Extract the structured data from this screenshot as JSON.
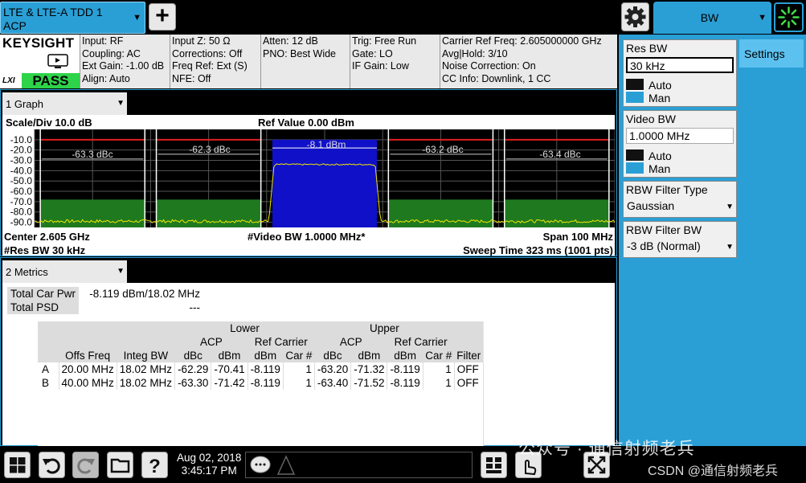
{
  "top_bar": {
    "mode_line1": "LTE & LTE-A TDD 1",
    "mode_line2": "ACP",
    "add_label": "+",
    "menu_label": "BW"
  },
  "info_bar": {
    "logo": "KEYSIGHT",
    "lxi": "LXI",
    "pass": "PASS",
    "col1": [
      "Input: RF",
      "Coupling: AC",
      "Ext Gain: -1.00 dB",
      "Align: Auto"
    ],
    "col2": [
      "Input Z: 50 Ω",
      "Corrections: Off",
      "Freq Ref: Ext (S)",
      "NFE: Off"
    ],
    "col3": [
      "Atten: 12 dB",
      "PNO: Best Wide"
    ],
    "col4": [
      "Trig: Free Run",
      "Gate: LO",
      "IF Gain: Low"
    ],
    "col5": [
      "Carrier Ref Freq: 2.605000000 GHz",
      "Avg|Hold: 3/10",
      "Noise Correction: On",
      "CC Info: Downlink, 1 CC"
    ]
  },
  "graph": {
    "tab": "1 Graph",
    "scale_div": "Scale/Div 10.0 dB",
    "ref_value": "Ref Value 0.00 dBm",
    "center": "Center 2.605 GHz",
    "video_bw": "#Video BW 1.0000 MHz*",
    "span": "Span 100 MHz",
    "res_bw": "#Res BW 30 kHz",
    "sweep": "Sweep Time 323 ms (1001 pts)",
    "y_ticks": [
      "-10.0",
      "-20.0",
      "-30.0",
      "-40.0",
      "-50.0",
      "-60.0",
      "-70.0",
      "-80.0",
      "-90.0"
    ],
    "band_labels": [
      "-63.3 dBc",
      "-62.3 dBc",
      "-8.1 dBm",
      "-63.2 dBc",
      "-63.4 dBc"
    ]
  },
  "chart_data": {
    "type": "line",
    "title": "",
    "y_ticks": [
      -10,
      -20,
      -30,
      -40,
      -50,
      -60,
      -70,
      -80,
      -90
    ],
    "ylim": [
      -95,
      0
    ],
    "x_center_ghz": 2.605,
    "x_span_mhz": 100,
    "channel_power_dbm": -8.1,
    "adjacent_dbc": [
      -63.3,
      -62.3,
      -63.2,
      -63.4
    ],
    "carrier_trace_level_dbm": -34,
    "noise_floor_dbm": -89,
    "limit_line_dbm": -10,
    "green_mask_dbm": -68
  },
  "metrics": {
    "tab": "2 Metrics",
    "total_car_pwr_label": "Total Car Pwr",
    "total_car_pwr_value": "-8.119 dBm/18.02 MHz",
    "total_psd_label": "Total PSD",
    "total_psd_value": "---",
    "header_lower": "Lower",
    "header_upper": "Upper",
    "header_acp": "ACP",
    "header_ref_carrier": "Ref Carrier",
    "columns": [
      "Offs Freq",
      "Integ BW",
      "dBc",
      "dBm",
      "dBm",
      "Car #",
      "dBc",
      "dBm",
      "dBm",
      "Car #",
      "Filter"
    ],
    "rows": [
      [
        "A",
        "20.00 MHz",
        "18.02 MHz",
        "-62.29",
        "-70.41",
        "-8.119",
        "1",
        "-63.20",
        "-71.32",
        "-8.119",
        "1",
        "OFF"
      ],
      [
        "B",
        "40.00 MHz",
        "18.02 MHz",
        "-63.30",
        "-71.42",
        "-8.119",
        "1",
        "-63.40",
        "-71.52",
        "-8.119",
        "1",
        "OFF"
      ]
    ]
  },
  "right_panel": {
    "settings_tab": "Settings",
    "res_bw_title": "Res BW",
    "res_bw_value": "30 kHz",
    "auto": "Auto",
    "man": "Man",
    "video_bw_title": "Video BW",
    "video_bw_value": "1.0000 MHz",
    "rbw_filter_type_title": "RBW Filter Type",
    "rbw_filter_type_value": "Gaussian",
    "rbw_filter_bw_title": "RBW Filter BW",
    "rbw_filter_bw_value": "-3 dB (Normal)"
  },
  "taskbar": {
    "date": "Aug 02, 2018",
    "time": "3:45:17 PM"
  },
  "watermark": {
    "line1": "公众号 · 通信射频老兵",
    "line2": "CSDN @通信射频老兵"
  },
  "colors": {
    "accent": "#2a9fd6",
    "pass": "#2ed34a",
    "carrier_fill": "#1010c8",
    "trace": "#f0e800",
    "mask_green": "#1f7a1f",
    "limit_red": "#e02020"
  }
}
